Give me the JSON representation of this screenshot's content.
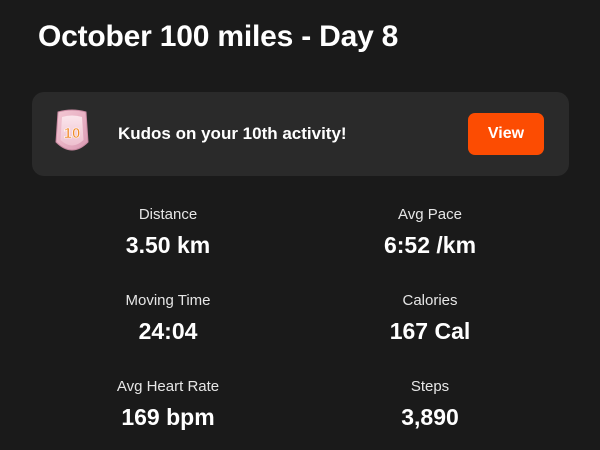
{
  "activity": {
    "title": "October 100 miles - Day 8"
  },
  "kudos_banner": {
    "badge_number": "10",
    "message": "Kudos on your 10th activity!",
    "view_label": "View",
    "accent_color": "#fc4c02",
    "badge_icon": "milestone-badge-icon"
  },
  "stats": [
    {
      "label": "Distance",
      "value": "3.50 km"
    },
    {
      "label": "Avg Pace",
      "value": "6:52 /km"
    },
    {
      "label": "Moving Time",
      "value": "24:04"
    },
    {
      "label": "Calories",
      "value": "167 Cal"
    },
    {
      "label": "Avg Heart Rate",
      "value": "169 bpm"
    },
    {
      "label": "Steps",
      "value": "3,890"
    }
  ]
}
